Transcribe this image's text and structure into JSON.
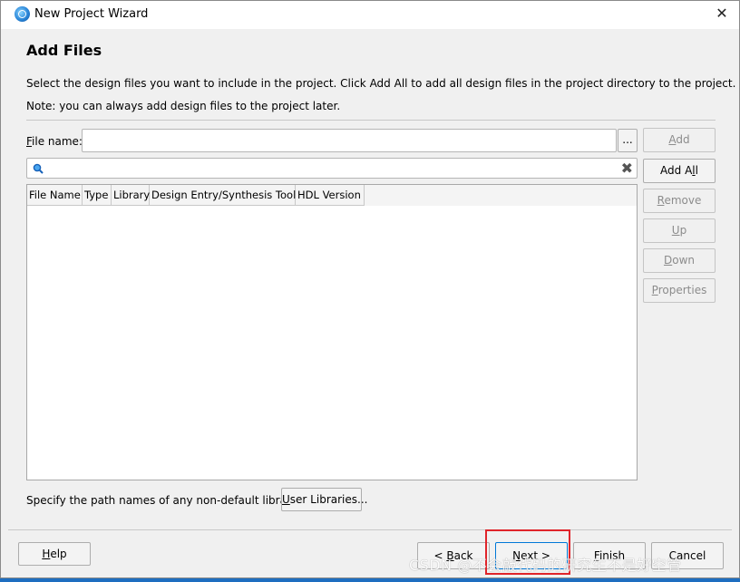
{
  "window": {
    "title": "New Project Wizard",
    "close_label": "✕"
  },
  "page": {
    "title": "Add Files",
    "description": "Select the design files you want to include in the project. Click Add All to add all design files in the project directory to the project.",
    "note": "Note: you can always add design files to the project later."
  },
  "file_name": {
    "label": "File name:",
    "value": "",
    "browse_label": "..."
  },
  "search": {
    "icon": "search-icon",
    "value": "",
    "clear_label": "✖"
  },
  "table": {
    "columns": [
      "File Name",
      "Type",
      "Library",
      "Design Entry/Synthesis Tool",
      "HDL Version"
    ],
    "rows": []
  },
  "side_buttons": {
    "add": "Add",
    "add_all": "Add All",
    "remove": "Remove",
    "up": "Up",
    "down": "Down",
    "properties": "Properties"
  },
  "libraries": {
    "text": "Specify the path names of any non-default libraries.",
    "button": "User Libraries..."
  },
  "footer": {
    "help": "Help",
    "back": "< Back",
    "next": "Next >",
    "finish": "Finish",
    "cancel": "Cancel"
  },
  "watermark": "CSDN @不会敲代码的研究生不是好空管",
  "colors": {
    "highlight_box": "#e0242a",
    "primary_border": "#0078d7",
    "desktop": "#1e6ec0"
  }
}
